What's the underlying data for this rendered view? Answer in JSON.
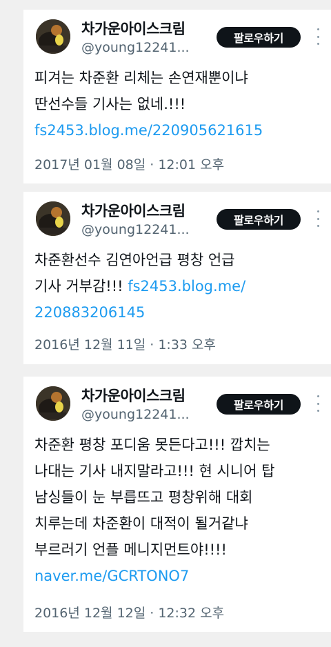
{
  "tweets": [
    {
      "author_name": "차가운아이스크림",
      "handle": "@young12241...",
      "follow_label": "팔로우하기",
      "lines": [
        "피겨는 차준환 리체는 손연재뿐이냐",
        "딴선수들 기사는 없네.!!!"
      ],
      "link_lines": [
        "fs2453.blog.me/220905621615"
      ],
      "timestamp": "2017년 01월 08일 · 12:01 오후"
    },
    {
      "author_name": "차가운아이스크림",
      "handle": "@young12241...",
      "follow_label": "팔로우하기",
      "lines": [
        "차준환선수 김연아언급 평창 언급"
      ],
      "mixed_line": {
        "text": "기사 거부감!!! ",
        "link": "fs2453.blog.me/"
      },
      "link_lines": [
        "220883206145"
      ],
      "timestamp": "2016년 12월 11일 · 1:33 오후"
    },
    {
      "author_name": "차가운아이스크림",
      "handle": "@young12241...",
      "follow_label": "팔로우하기",
      "lines": [
        "차준환 평창 포디움 못든다고!!! 깝치는",
        "나대는 기사 내지말라고!!! 현 시니어 탑",
        "남싱들이 눈 부릅뜨고 평창위해 대회",
        "치루는데 차준환이 대적이 될거같냐",
        "부르러기 언플 메니지먼트야!!!!"
      ],
      "link_lines": [
        "naver.me/GCRTONO7"
      ],
      "timestamp": "2016년 12월 12일 · 12:32 오후"
    }
  ],
  "icons": {
    "more": "more-vertical-icon",
    "avatar": "avatar-image"
  },
  "colors": {
    "link": "#1d9bf0",
    "follow_bg": "#0f1419",
    "meta": "#536471",
    "page_bg": "#f0f0f0"
  }
}
